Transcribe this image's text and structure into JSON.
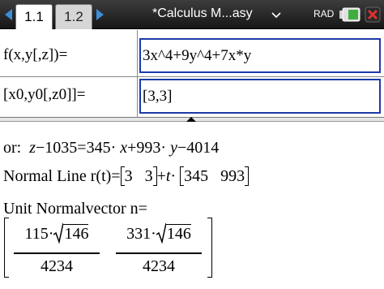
{
  "titlebar": {
    "tabs": [
      {
        "label": "1.1",
        "active": true
      },
      {
        "label": "1.2",
        "active": false
      }
    ],
    "document_title": "*Calculus M...asy",
    "angle_mode": "RAD",
    "accent_color": "#3b8fd9",
    "close_color": "#e03030"
  },
  "inputs": [
    {
      "label": "f(x,y[,z])=",
      "value": "3x^4+9y^4+7x*y"
    },
    {
      "label": "[x0,y0[,z0]]=",
      "value": "[3,3]"
    }
  ],
  "results": {
    "tangent_plane": {
      "prefix": "or:",
      "lhs_var": "z",
      "lhs_rest": "−1035=345·",
      "x_var": "x",
      "mid": "+993·",
      "y_var": "y",
      "tail": "−4014"
    },
    "normal_line": {
      "label": "Normal Line r(t)=",
      "point": [
        "3",
        "3"
      ],
      "plus": "+",
      "t_var": "t",
      "dot": "·",
      "direction": [
        "345",
        "993"
      ]
    },
    "unit_normal": {
      "label": "Unit Normalvector n=",
      "components": [
        {
          "coef": "115·",
          "radicand": "146",
          "denominator": "4234"
        },
        {
          "coef": "331·",
          "radicand": "146",
          "denominator": "4234"
        }
      ]
    }
  },
  "icons": [
    "nav-left-icon",
    "nav-right-icon",
    "chevron-down-icon",
    "battery-icon",
    "close-icon"
  ]
}
